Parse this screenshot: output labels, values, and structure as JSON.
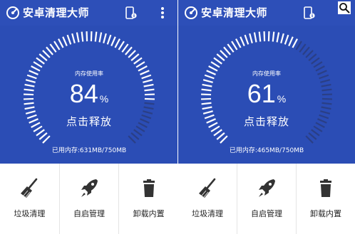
{
  "screens": [
    {
      "app_title": "安卓清理大师",
      "memory_label": "内存使用率",
      "usage_percent": 84,
      "percent_sign": "%",
      "release_label": "点击释放",
      "used_memory_text": "已用内存:631MB/750MB",
      "tools": [
        {
          "label": "垃圾清理",
          "icon": "broom-icon"
        },
        {
          "label": "自启管理",
          "icon": "rocket-icon"
        },
        {
          "label": "卸载内置",
          "icon": "trash-icon"
        }
      ]
    },
    {
      "app_title": "安卓清理大师",
      "memory_label": "内存使用率",
      "usage_percent": 61,
      "percent_sign": "%",
      "release_label": "点击释放",
      "used_memory_text": "已用内存:465MB/750MB",
      "tools": [
        {
          "label": "垃圾清理",
          "icon": "broom-icon"
        },
        {
          "label": "自启管理",
          "icon": "rocket-icon"
        },
        {
          "label": "卸载内置",
          "icon": "trash-icon"
        }
      ]
    }
  ],
  "colors": {
    "background": "#2b4db5",
    "tick_active": "#ffffff",
    "tick_inactive": "#2a3f86"
  },
  "icons": {
    "app_logo": "speedometer-icon",
    "device_info": "phone-info-icon",
    "overflow": "more-vertical-icon",
    "search": "search-icon"
  }
}
